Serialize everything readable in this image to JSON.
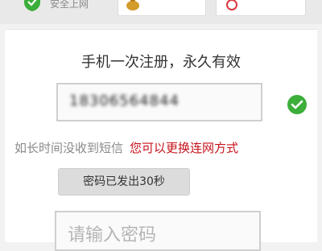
{
  "header": {
    "safe_label": "安全上网"
  },
  "main": {
    "title": "手机一次注册，永久有效",
    "phone_value": "18306564844",
    "hint_gray": "如长时间没收到短信",
    "hint_link": "您可以更换连网方式",
    "sent_button_label": "密码已发出30秒",
    "password_placeholder": "请输入密码"
  },
  "colors": {
    "accent_green": "#3cae3a",
    "link_red": "#c7121b"
  }
}
